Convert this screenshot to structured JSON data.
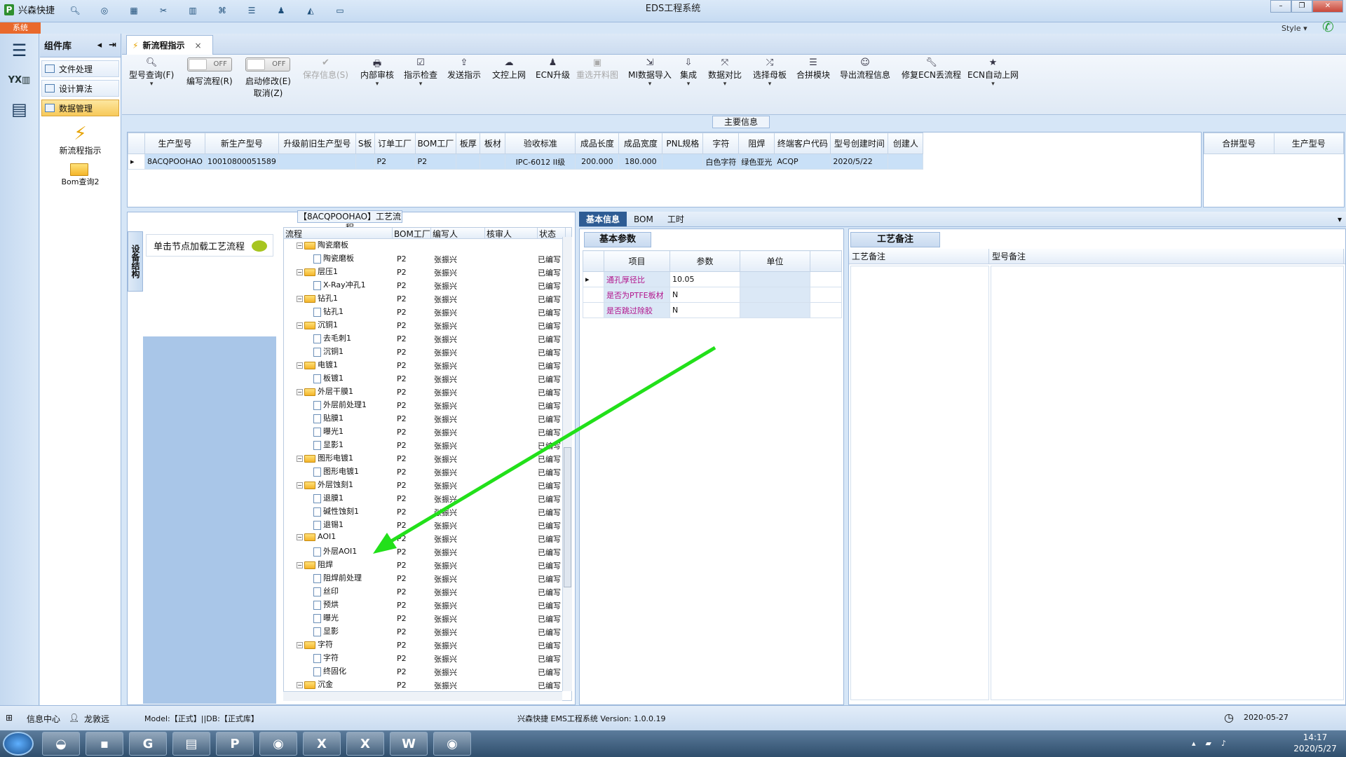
{
  "window": {
    "brand": "兴森快捷",
    "title": "EDS工程系统",
    "sys_tab": "系统",
    "style_label": "Style"
  },
  "quick_icons": [
    "search-icon",
    "globe-icon",
    "grid-icon",
    "scissors-icon",
    "film-icon",
    "tree-icon",
    "list-icon",
    "user-icon",
    "chart-icon",
    "monitor-icon"
  ],
  "component_panel": {
    "title": "组件库",
    "items": [
      {
        "label": "文件处理",
        "selected": false
      },
      {
        "label": "设计算法",
        "selected": false
      },
      {
        "label": "数据管理",
        "selected": true
      }
    ],
    "tools": [
      {
        "label": "新流程指示",
        "icon": "lightning-icon"
      },
      {
        "label": "Bom查询2",
        "icon": "folder-icon"
      }
    ]
  },
  "doc_tab": {
    "label": "新流程指示"
  },
  "toolbar": {
    "model_query": "型号查询(F)",
    "toggle_off": "OFF",
    "write_flow": "编写流程(R)",
    "start_edit": "启动修改(E)",
    "cancel": "取消(Z)",
    "save_info": "保存信息(S)",
    "internal_review": "内部审核",
    "instruction_check": "指示检查",
    "send_instruction": "发送指示",
    "upload_text": "文控上网",
    "ecn_upgrade": "ECN升级",
    "redraw_cut": "重选开料图",
    "mi_import": "MI数据导入",
    "integrate": "集成",
    "compare": "数据对比",
    "choose_template": "选择母板",
    "merge_module": "合拼模块",
    "export_flow": "导出流程信息",
    "repair_ecn": "修复ECN丢流程",
    "ecn_auto": "ECN自动上网"
  },
  "main_info": {
    "label": "主要信息",
    "columns": [
      "生产型号",
      "新生产型号",
      "升级前旧生产型号",
      "S板",
      "订单工厂",
      "BOM工厂",
      "板厚",
      "板材",
      "验收标准",
      "成品长度",
      "成品宽度",
      "PNL规格",
      "字符",
      "阻焊",
      "终端客户代码",
      "型号创建时间",
      "创建人"
    ],
    "row": [
      "8ACQPOOHAO",
      "10010800051589",
      "",
      "",
      "P2",
      "P2",
      "",
      "",
      "IPC-6012 II级",
      "200.000",
      "180.000",
      "",
      "白色字符",
      "绿色亚光",
      "ACQP",
      "2020/5/22",
      ""
    ],
    "right_columns": [
      "合拼型号",
      "生产型号"
    ]
  },
  "flow_panel": {
    "title": "【8ACQPOOHAO】工艺流程",
    "vertical_tab": "设备结构",
    "node_hint": "单击节点加载工艺流程",
    "columns": [
      "流程",
      "BOM工厂",
      "编写人",
      "核审人",
      "状态"
    ],
    "rows": [
      {
        "name": "陶瓷磨板",
        "level": 0,
        "bom": "",
        "writer": "",
        "reviewer": "",
        "status": ""
      },
      {
        "name": "陶瓷磨板",
        "level": 1,
        "bom": "P2",
        "writer": "张振兴",
        "reviewer": "",
        "status": "已编写"
      },
      {
        "name": "层压1",
        "level": 0,
        "bom": "P2",
        "writer": "张振兴",
        "reviewer": "",
        "status": "已编写"
      },
      {
        "name": "X-Ray冲孔1",
        "level": 1,
        "bom": "P2",
        "writer": "张振兴",
        "reviewer": "",
        "status": "已编写"
      },
      {
        "name": "钻孔1",
        "level": 0,
        "bom": "P2",
        "writer": "张振兴",
        "reviewer": "",
        "status": "已编写"
      },
      {
        "name": "钻孔1",
        "level": 1,
        "bom": "P2",
        "writer": "张振兴",
        "reviewer": "",
        "status": "已编写"
      },
      {
        "name": "沉铜1",
        "level": 0,
        "bom": "P2",
        "writer": "张振兴",
        "reviewer": "",
        "status": "已编写"
      },
      {
        "name": "去毛刺1",
        "level": 1,
        "bom": "P2",
        "writer": "张振兴",
        "reviewer": "",
        "status": "已编写"
      },
      {
        "name": "沉铜1",
        "level": 1,
        "bom": "P2",
        "writer": "张振兴",
        "reviewer": "",
        "status": "已编写"
      },
      {
        "name": "电镀1",
        "level": 0,
        "bom": "P2",
        "writer": "张振兴",
        "reviewer": "",
        "status": "已编写"
      },
      {
        "name": "板镀1",
        "level": 1,
        "bom": "P2",
        "writer": "张振兴",
        "reviewer": "",
        "status": "已编写"
      },
      {
        "name": "外层干膜1",
        "level": 0,
        "bom": "P2",
        "writer": "张振兴",
        "reviewer": "",
        "status": "已编写"
      },
      {
        "name": "外层前处理1",
        "level": 1,
        "bom": "P2",
        "writer": "张振兴",
        "reviewer": "",
        "status": "已编写"
      },
      {
        "name": "贴膜1",
        "level": 1,
        "bom": "P2",
        "writer": "张振兴",
        "reviewer": "",
        "status": "已编写"
      },
      {
        "name": "曝光1",
        "level": 1,
        "bom": "P2",
        "writer": "张振兴",
        "reviewer": "",
        "status": "已编写"
      },
      {
        "name": "显影1",
        "level": 1,
        "bom": "P2",
        "writer": "张振兴",
        "reviewer": "",
        "status": "已编写"
      },
      {
        "name": "图形电镀1",
        "level": 0,
        "bom": "P2",
        "writer": "张振兴",
        "reviewer": "",
        "status": "已编写"
      },
      {
        "name": "图形电镀1",
        "level": 1,
        "bom": "P2",
        "writer": "张振兴",
        "reviewer": "",
        "status": "已编写"
      },
      {
        "name": "外层蚀刻1",
        "level": 0,
        "bom": "P2",
        "writer": "张振兴",
        "reviewer": "",
        "status": "已编写"
      },
      {
        "name": "退膜1",
        "level": 1,
        "bom": "P2",
        "writer": "张振兴",
        "reviewer": "",
        "status": "已编写"
      },
      {
        "name": "碱性蚀刻1",
        "level": 1,
        "bom": "P2",
        "writer": "张振兴",
        "reviewer": "",
        "status": "已编写"
      },
      {
        "name": "退锡1",
        "level": 1,
        "bom": "P2",
        "writer": "张振兴",
        "reviewer": "",
        "status": "已编写"
      },
      {
        "name": "AOI1",
        "level": 0,
        "bom": "P2",
        "writer": "张振兴",
        "reviewer": "",
        "status": "已编写"
      },
      {
        "name": "外层AOI1",
        "level": 1,
        "bom": "P2",
        "writer": "张振兴",
        "reviewer": "",
        "status": "已编写"
      },
      {
        "name": "阻焊",
        "level": 0,
        "bom": "P2",
        "writer": "张振兴",
        "reviewer": "",
        "status": "已编写"
      },
      {
        "name": "阻焊前处理",
        "level": 1,
        "bom": "P2",
        "writer": "张振兴",
        "reviewer": "",
        "status": "已编写"
      },
      {
        "name": "丝印",
        "level": 1,
        "bom": "P2",
        "writer": "张振兴",
        "reviewer": "",
        "status": "已编写"
      },
      {
        "name": "预烘",
        "level": 1,
        "bom": "P2",
        "writer": "张振兴",
        "reviewer": "",
        "status": "已编写"
      },
      {
        "name": "曝光",
        "level": 1,
        "bom": "P2",
        "writer": "张振兴",
        "reviewer": "",
        "status": "已编写"
      },
      {
        "name": "显影",
        "level": 1,
        "bom": "P2",
        "writer": "张振兴",
        "reviewer": "",
        "status": "已编写"
      },
      {
        "name": "字符",
        "level": 0,
        "bom": "P2",
        "writer": "张振兴",
        "reviewer": "",
        "status": "已编写"
      },
      {
        "name": "字符",
        "level": 1,
        "bom": "P2",
        "writer": "张振兴",
        "reviewer": "",
        "status": "已编写"
      },
      {
        "name": "终固化",
        "level": 1,
        "bom": "P2",
        "writer": "张振兴",
        "reviewer": "",
        "status": "已编写"
      },
      {
        "name": "沉金",
        "level": 0,
        "bom": "P2",
        "writer": "张振兴",
        "reviewer": "",
        "status": "已编写"
      }
    ]
  },
  "right_tabs": [
    "基本信息",
    "BOM",
    "工时"
  ],
  "basic_params": {
    "title": "基本参数",
    "columns": [
      "项目",
      "参数",
      "单位"
    ],
    "rows": [
      {
        "item": "通孔厚径比",
        "value": "10.05",
        "unit": ""
      },
      {
        "item": "是否为PTFE板材",
        "value": "N",
        "unit": ""
      },
      {
        "item": "是否跳过除胶",
        "value": "N",
        "unit": ""
      }
    ]
  },
  "process_notes": {
    "title": "工艺备注",
    "columns": [
      "工艺备注",
      "型号备注"
    ]
  },
  "status_bar": {
    "info_center": "信息中心",
    "user": "龙敦远",
    "model": "Model:【正式】||DB:【正式库】",
    "app": "兴森快捷 EMS工程系统 Version: 1.0.0.19",
    "date": "2020-05-27"
  },
  "taskbar": {
    "time": "14:17",
    "date": "2020/5/27"
  },
  "colors": {
    "accent": "#2e5c94",
    "selection": "#c9e0f7",
    "folder": "#f4b52a",
    "annotation_arrow": "#22e01a"
  }
}
